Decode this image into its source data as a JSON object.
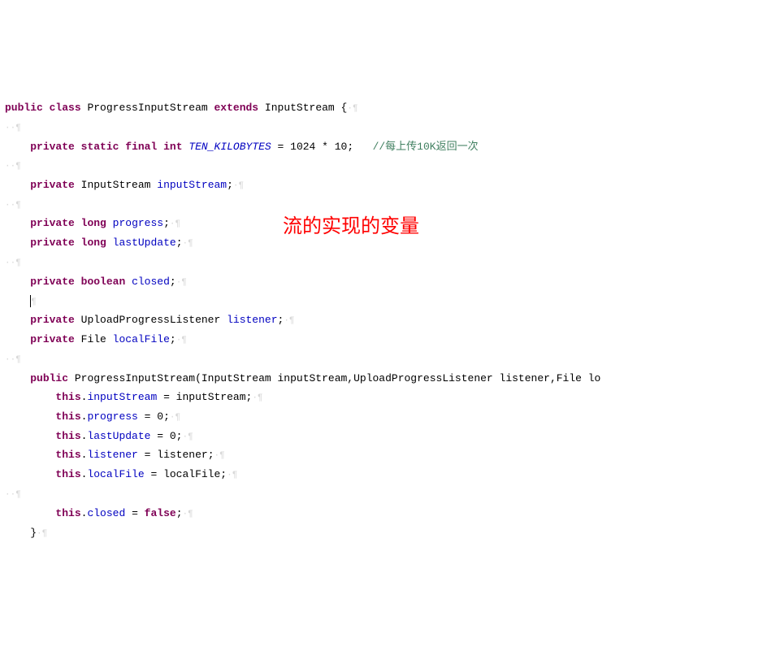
{
  "annotation": "流的实现的变量",
  "ws": {
    "lead": "··¶",
    "trail": "·¶",
    "space": "¶"
  },
  "comment": "//每上传10K返回一次",
  "code": {
    "l1": {
      "a": "public",
      "b": "class",
      "c": "ProgressInputStream",
      "d": "extends",
      "e": "InputStream {"
    },
    "l2": {
      "a": "private",
      "b": "static",
      "c": "final",
      "d": "int",
      "e": "TEN_KILOBYTES",
      "f": " = 1024 * 10;"
    },
    "l3": {
      "a": "private",
      "b": "InputStream",
      "c": "inputStream",
      "d": ";"
    },
    "l4": {
      "a": "private",
      "b": "long",
      "c": "progress",
      "d": ";"
    },
    "l5": {
      "a": "private",
      "b": "long",
      "c": "lastUpdate",
      "d": ";"
    },
    "l6": {
      "a": "private",
      "b": "boolean",
      "c": "closed",
      "d": ";"
    },
    "l7": {
      "a": "private",
      "b": "UploadProgressListener",
      "c": "listener",
      "d": ";"
    },
    "l8": {
      "a": "private",
      "b": "File",
      "c": "localFile",
      "d": ";"
    },
    "l9": {
      "a": "public",
      "b": "ProgressInputStream(InputStream inputStream,UploadProgressListener listener,File lo"
    },
    "l10": {
      "a": "this",
      "b": ".",
      "c": "inputStream",
      "d": " = inputStream;"
    },
    "l11": {
      "a": "this",
      "b": ".",
      "c": "progress",
      "d": " = 0;"
    },
    "l12": {
      "a": "this",
      "b": ".",
      "c": "lastUpdate",
      "d": " = 0;"
    },
    "l13": {
      "a": "this",
      "b": ".",
      "c": "listener",
      "d": " = listener;"
    },
    "l14": {
      "a": "this",
      "b": ".",
      "c": "localFile",
      "d": " = localFile;"
    },
    "l15": {
      "a": "this",
      "b": ".",
      "c": "closed",
      "d": " = ",
      "e": "false",
      "f": ";"
    },
    "l16": {
      "a": "}"
    }
  }
}
